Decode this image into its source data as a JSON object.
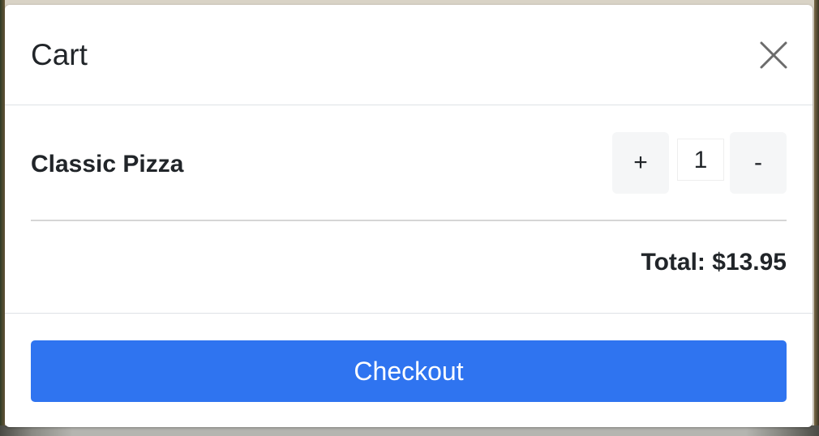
{
  "modal": {
    "title": "Cart",
    "close_icon": "close-icon"
  },
  "cart": {
    "items": [
      {
        "name": "Classic Pizza",
        "quantity": "1",
        "increment_label": "+",
        "decrement_label": "-"
      }
    ],
    "total_label": "Total: $13.95"
  },
  "footer": {
    "checkout_label": "Checkout"
  },
  "colors": {
    "accent": "#2f74f0",
    "text": "#212529",
    "qty_button_bg": "#f5f6f7",
    "divider": "#dee2e6"
  }
}
